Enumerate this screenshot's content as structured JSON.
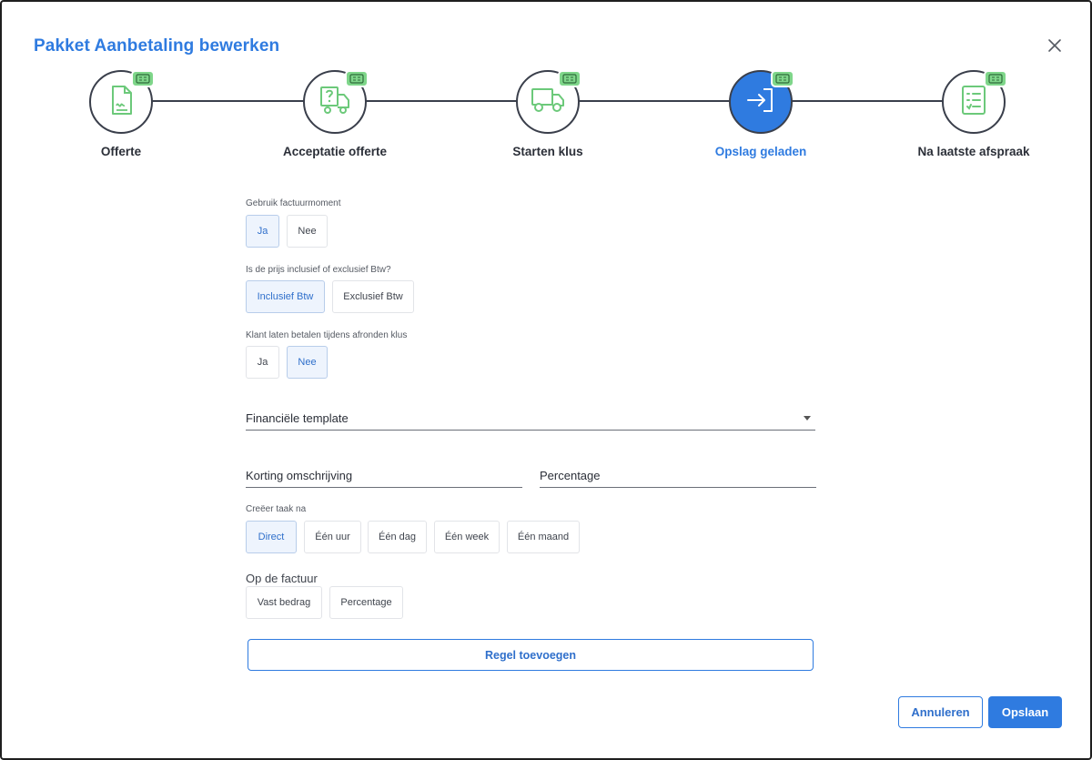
{
  "dialog": {
    "title": "Pakket Aanbetaling bewerken"
  },
  "steps": [
    {
      "label": "Offerte",
      "icon": "document-signature-icon"
    },
    {
      "label": "Acceptatie offerte",
      "icon": "delivery-question-icon"
    },
    {
      "label": "Starten klus",
      "icon": "truck-icon"
    },
    {
      "label": "Opslag geladen",
      "icon": "login-arrow-icon"
    },
    {
      "label": "Na laatste afspraak",
      "icon": "checklist-icon"
    }
  ],
  "active_step": 3,
  "colors": {
    "accent": "#2f7be0",
    "badge": "#7fd68a",
    "step_icon": "#6cc97a",
    "line": "#3a3f4b"
  },
  "invoice_moment": {
    "label": "Gebruik factuurmoment",
    "options": [
      "Ja",
      "Nee"
    ],
    "selected": "Ja"
  },
  "vat": {
    "label": "Is de prijs inclusief of exclusief Btw?",
    "options": [
      "Inclusief Btw",
      "Exclusief Btw"
    ],
    "selected": "Inclusief Btw"
  },
  "pay_on_finish": {
    "label": "Klant laten betalen tijdens afronden klus",
    "options": [
      "Ja",
      "Nee"
    ],
    "selected": "Nee"
  },
  "financial_template": {
    "placeholder": "Financiële template"
  },
  "discount_description": {
    "placeholder": "Korting omschrijving"
  },
  "percentage": {
    "placeholder": "Percentage"
  },
  "create_task": {
    "label": "Creëer taak na",
    "options": [
      "Direct",
      "Één uur",
      "Één dag",
      "Één week",
      "Één maand"
    ],
    "selected": "Direct"
  },
  "invoice": {
    "label": "Op de factuur",
    "options": [
      "Vast bedrag",
      "Percentage"
    ]
  },
  "buttons": {
    "add_rule": "Regel toevoegen",
    "cancel": "Annuleren",
    "save": "Opslaan"
  }
}
